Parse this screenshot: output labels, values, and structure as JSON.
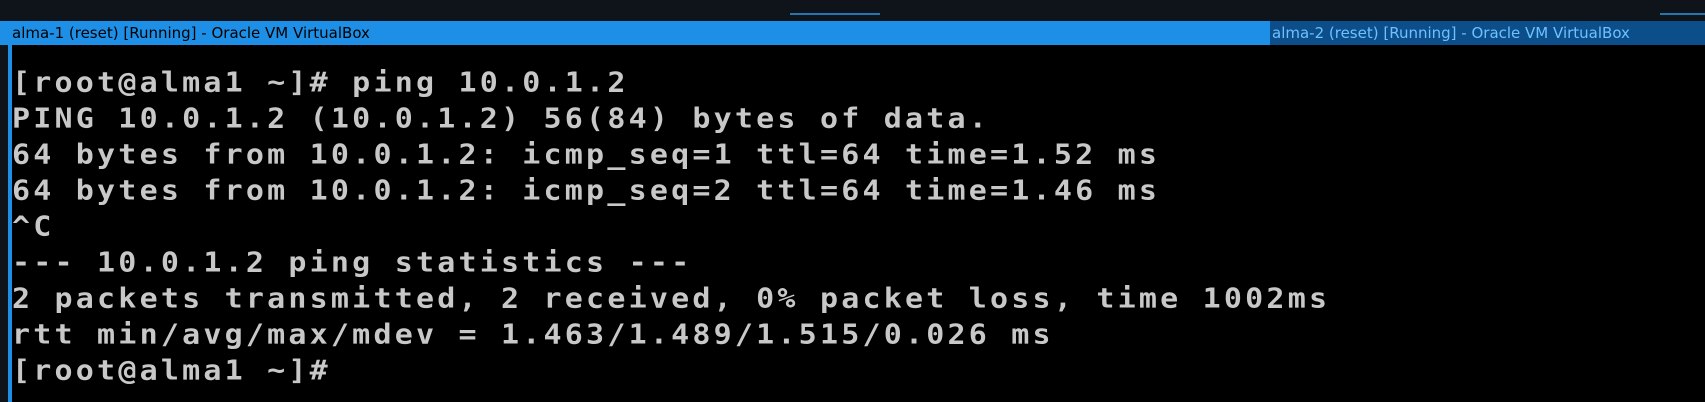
{
  "windows": {
    "left_title": "alma-1 (reset) [Running] - Oracle VM VirtualBox",
    "right_title": "alma-2 (reset) [Running] - Oracle VM VirtualBox"
  },
  "terminal": {
    "lines": [
      "[root@alma1 ~]# ping 10.0.1.2",
      "PING 10.0.1.2 (10.0.1.2) 56(84) bytes of data.",
      "64 bytes from 10.0.1.2: icmp_seq=1 ttl=64 time=1.52 ms",
      "64 bytes from 10.0.1.2: icmp_seq=2 ttl=64 time=1.46 ms",
      "^C",
      "--- 10.0.1.2 ping statistics ---",
      "2 packets transmitted, 2 received, 0% packet loss, time 1002ms",
      "rtt min/avg/max/mdev = 1.463/1.489/1.515/0.026 ms",
      "[root@alma1 ~]#"
    ]
  },
  "colors": {
    "titlebar_active": "#1e8fe6",
    "titlebar_inactive": "#0b4e8a",
    "console_bg": "#000000",
    "console_text": "#c8c8c8"
  }
}
